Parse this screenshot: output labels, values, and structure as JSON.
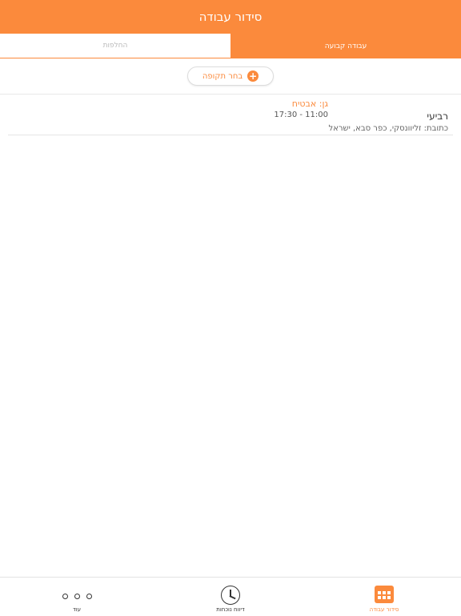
{
  "header": {
    "title": "סידור עבודה"
  },
  "tabs": [
    {
      "label": "החלפות",
      "active": false
    },
    {
      "label": "עבודה קבועה",
      "active": true
    }
  ],
  "period_button": {
    "label": "בחר תקופה",
    "icon": "plus-circle-icon"
  },
  "entries": [
    {
      "day": "רביעי",
      "garden": "גן: אבטיח",
      "hours": "17:30 - 11:00",
      "address": "כתובת: זליוונסקי, כפר סבא, ישראל"
    }
  ],
  "bottom_nav": [
    {
      "label": "עוד",
      "icon": "more-dots-icon",
      "active": false
    },
    {
      "label": "דיווח נוכחות",
      "icon": "clock-icon",
      "active": false
    },
    {
      "label": "סידור עבודה",
      "icon": "calendar-icon",
      "active": true
    }
  ],
  "colors": {
    "accent": "#fb8a3c"
  }
}
